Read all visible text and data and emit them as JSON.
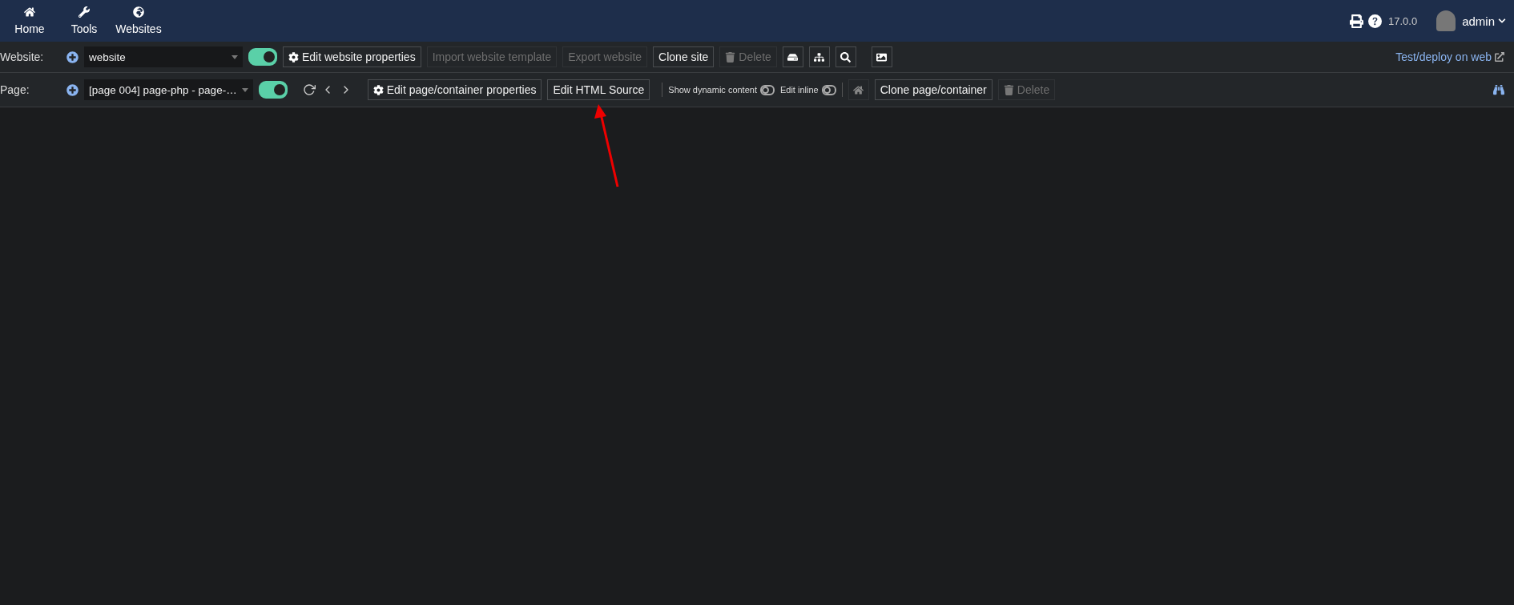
{
  "nav": [
    {
      "label": "Home"
    },
    {
      "label": "Tools"
    },
    {
      "label": "Websites"
    }
  ],
  "version": "17.0.0",
  "user": {
    "name": "admin"
  },
  "website_row": {
    "label": "Website:",
    "select": "website",
    "toggle_on": true,
    "buttons": [
      {
        "label": "Edit website properties",
        "disabled": false
      },
      {
        "label": "Import website template",
        "disabled": true
      },
      {
        "label": "Export website",
        "disabled": true
      },
      {
        "label": "Clone site",
        "disabled": false
      },
      {
        "label": "Delete",
        "disabled": true
      }
    ],
    "link": "Test/deploy on web"
  },
  "page_row": {
    "label": "Page:",
    "select": "[page 004] page-php - page-…",
    "toggle_on": true,
    "buttons": [
      {
        "label": "Edit page/container properties",
        "disabled": false
      },
      {
        "label": "Edit HTML Source",
        "disabled": false
      }
    ],
    "switches": [
      {
        "label": "Show dynamic content",
        "on": false
      },
      {
        "label": "Edit inline",
        "on": false
      }
    ],
    "clone": {
      "label": "Clone page/container",
      "disabled": false
    },
    "delete": {
      "label": "Delete",
      "disabled": true
    }
  }
}
